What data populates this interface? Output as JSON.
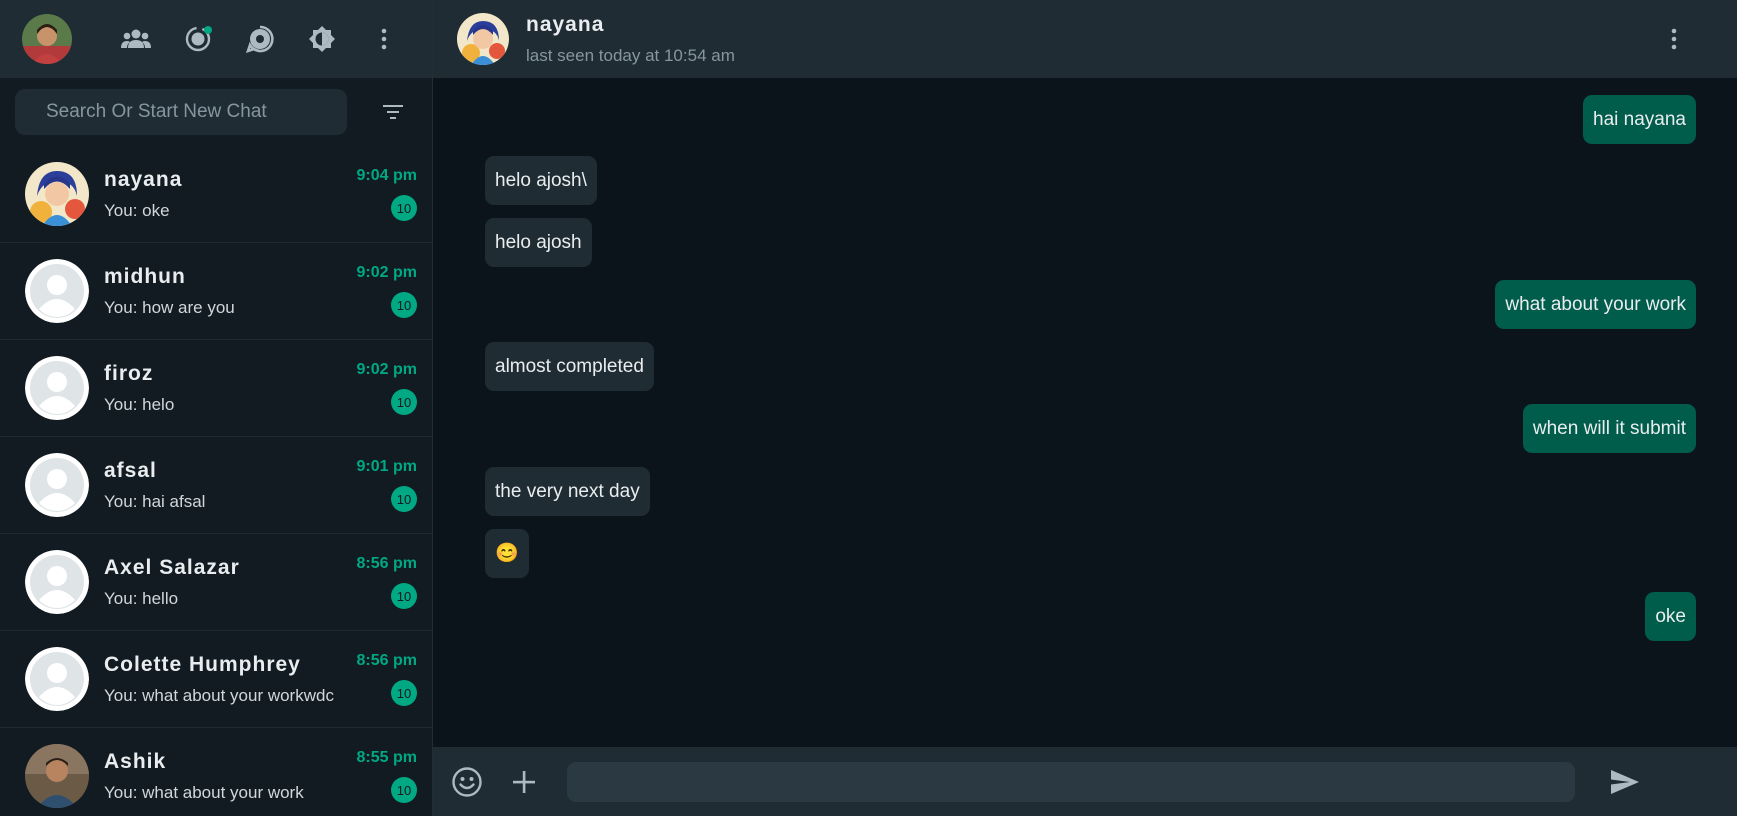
{
  "sidebar": {
    "search_placeholder": "Search Or Start New Chat",
    "chats": [
      {
        "name": "nayana",
        "preview": "You: oke",
        "time": "9:04 pm",
        "unread": "10",
        "avatar": "nayana-avatar"
      },
      {
        "name": "midhun",
        "preview": "You: how are you",
        "time": "9:02 pm",
        "unread": "10",
        "avatar": "default-avatar"
      },
      {
        "name": "firoz",
        "preview": "You: helo",
        "time": "9:02 pm",
        "unread": "10",
        "avatar": "default-avatar"
      },
      {
        "name": "afsal",
        "preview": "You: hai afsal",
        "time": "9:01 pm",
        "unread": "10",
        "avatar": "default-avatar"
      },
      {
        "name": "Axel Salazar",
        "preview": "You: hello",
        "time": "8:56 pm",
        "unread": "10",
        "avatar": "default-avatar"
      },
      {
        "name": "Colette Humphrey",
        "preview": "You: what about your workwdc",
        "time": "8:56 pm",
        "unread": "10",
        "avatar": "default-avatar"
      },
      {
        "name": "Ashik",
        "preview": "You: what about your work",
        "time": "8:55 pm",
        "unread": "10",
        "avatar": "photo-avatar"
      }
    ]
  },
  "header": {
    "contact_name": "nayana",
    "contact_status": "last seen today at 10:54 am"
  },
  "messages": [
    {
      "text": "hai nayana",
      "direction": "out"
    },
    {
      "text": "helo ajosh\\",
      "direction": "in"
    },
    {
      "text": "helo ajosh",
      "direction": "in"
    },
    {
      "text": "what about your work",
      "direction": "out"
    },
    {
      "text": "almost completed",
      "direction": "in"
    },
    {
      "text": "when will it submit",
      "direction": "out"
    },
    {
      "text": "the very next day",
      "direction": "in"
    },
    {
      "text": "😊",
      "direction": "in"
    },
    {
      "text": "oke",
      "direction": "out"
    }
  ],
  "colors": {
    "accent": "#00a884",
    "outgoing_bubble": "#005c4b",
    "incoming_bubble": "#1f2c33",
    "panel": "#202c33",
    "background": "#0c141b"
  }
}
